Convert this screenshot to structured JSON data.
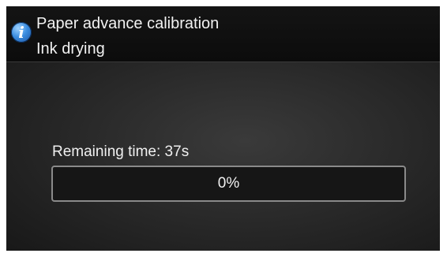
{
  "header": {
    "icon": "info-icon",
    "title": "Paper advance calibration",
    "subtitle": "Ink drying"
  },
  "status": {
    "remaining_label": "Remaining time: 37s"
  },
  "progress": {
    "value": 0,
    "label": "0%"
  },
  "colors": {
    "header_background": "#0c0c0c",
    "body_background": "#262626",
    "text": "#f2f2f2",
    "progress_border": "#8a8a8a",
    "info_icon": "#3b8de0"
  }
}
